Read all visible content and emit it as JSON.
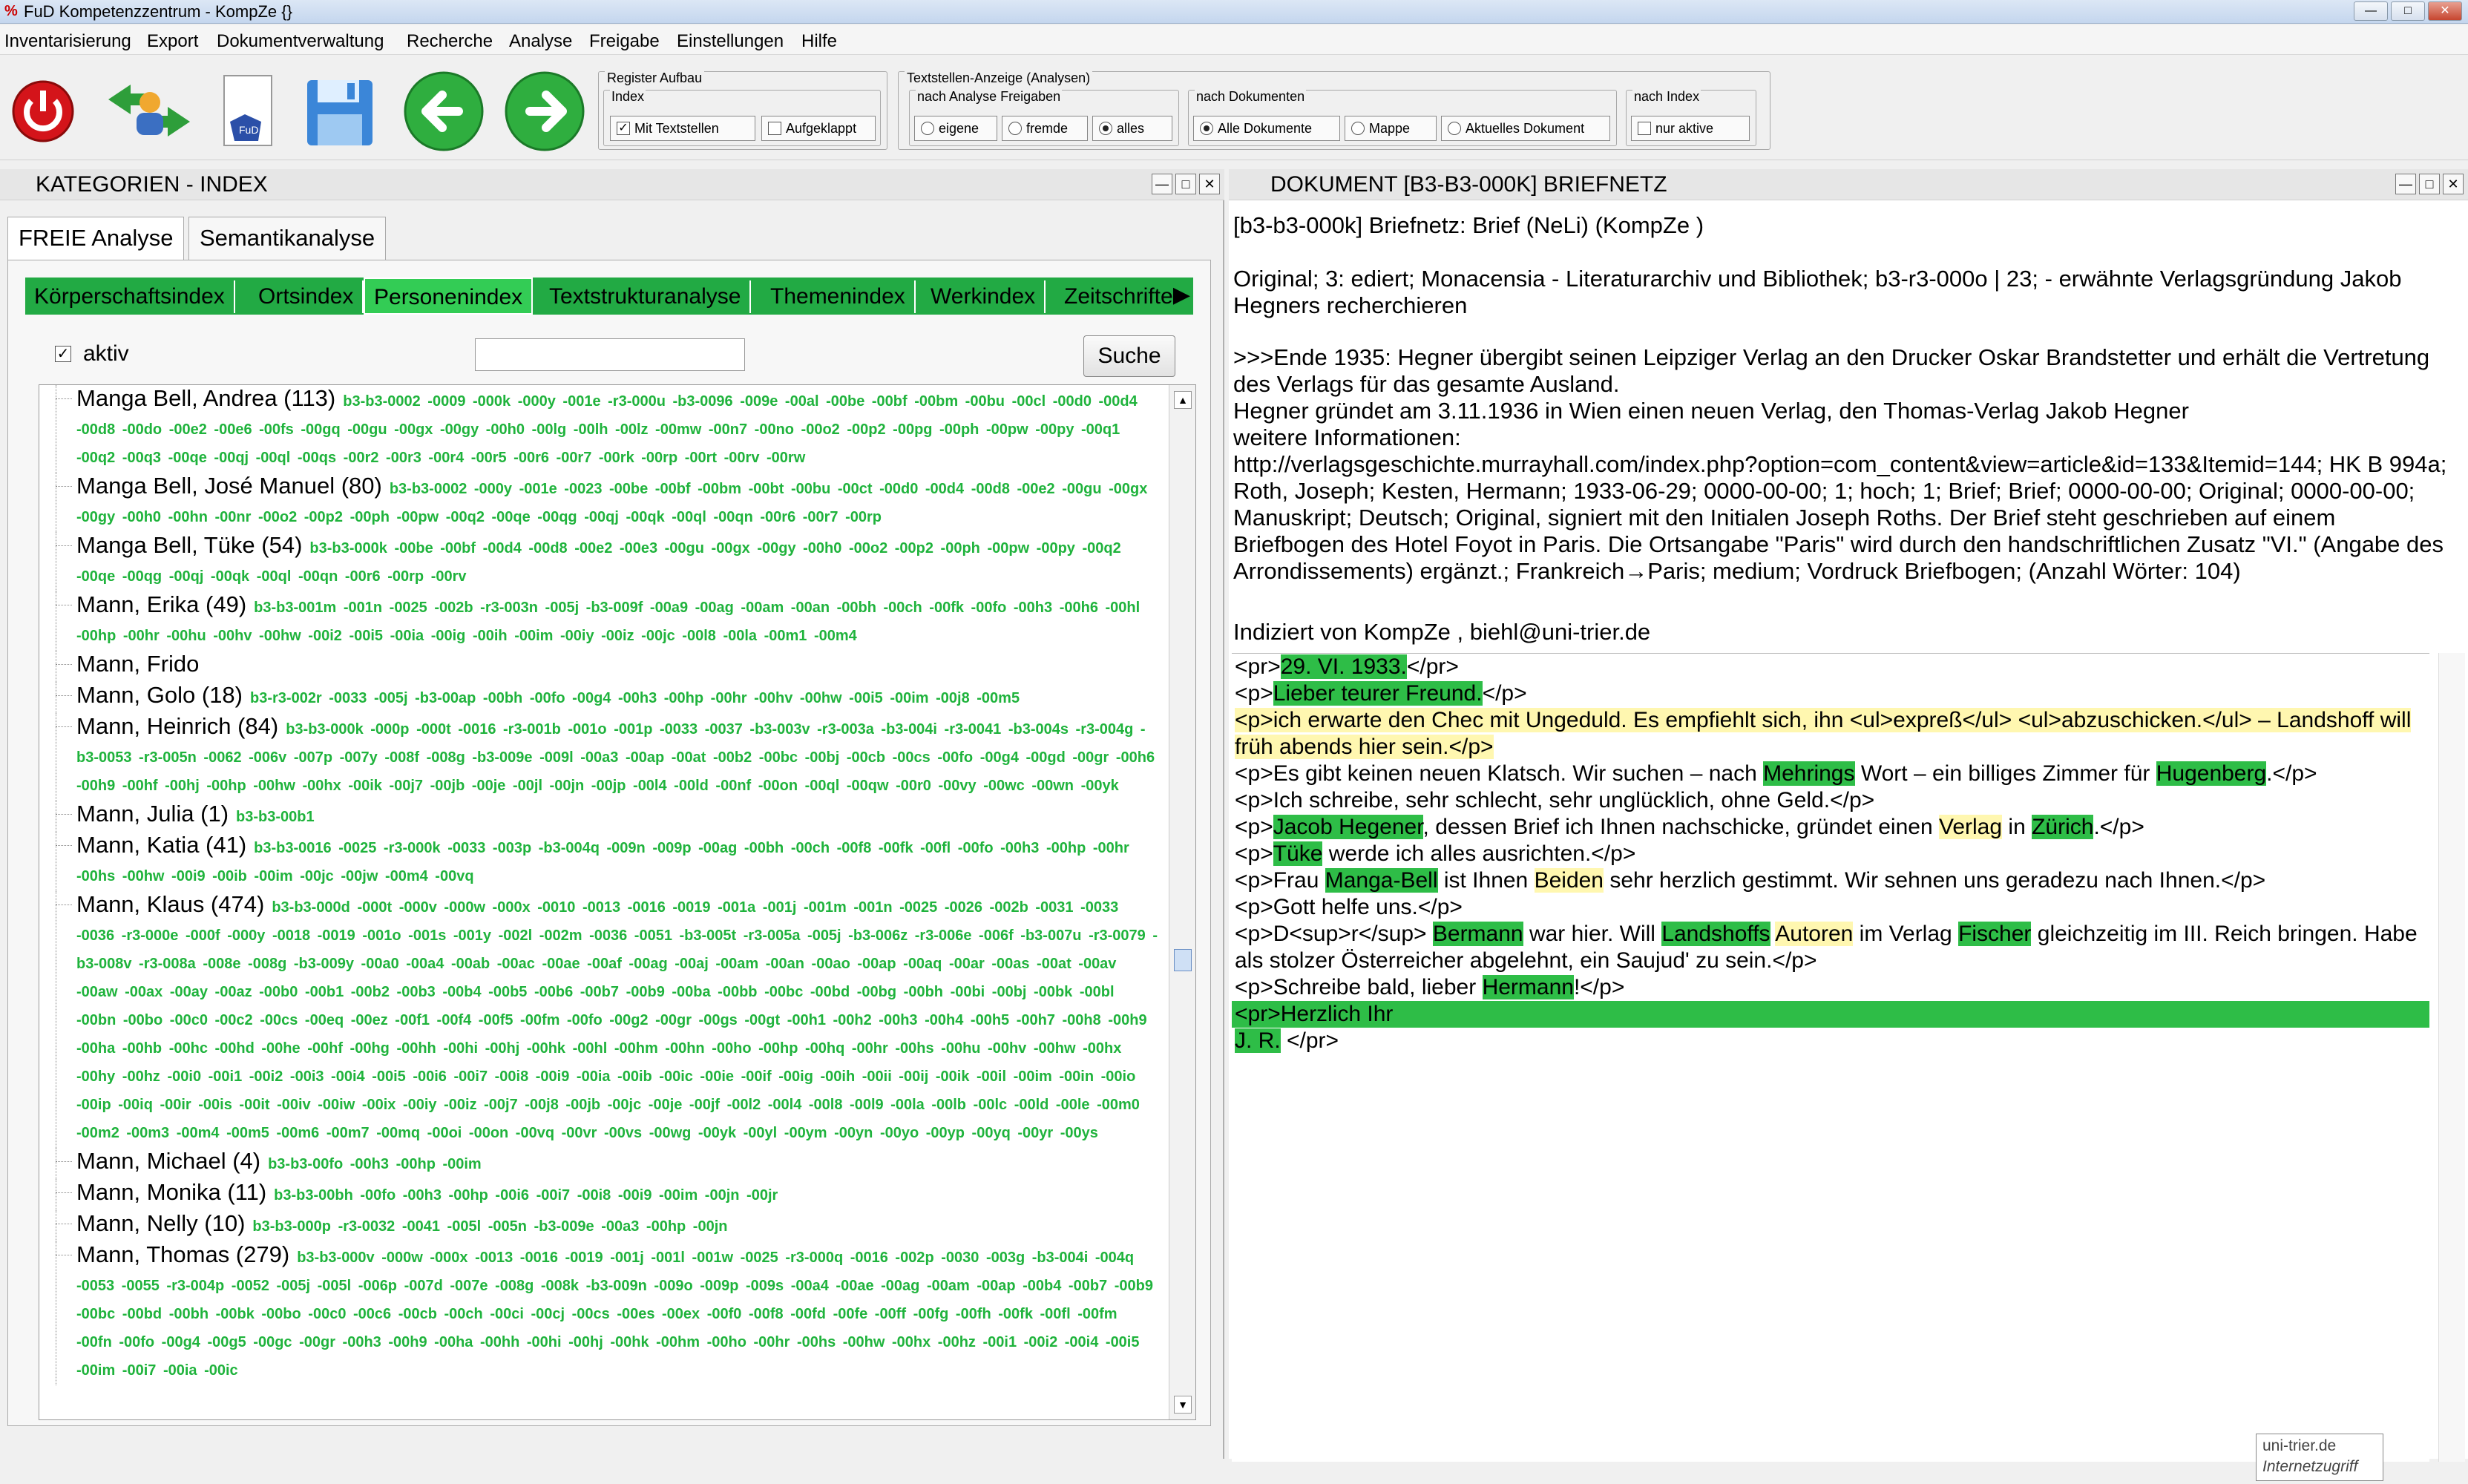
{
  "window": {
    "title": "FuD Kompetenzzentrum - KompZe {}",
    "app_icon": "fud-app-icon"
  },
  "menu": [
    "Inventarisierung",
    "Export",
    "Dokumentverwaltung",
    "Recherche",
    "Analyse",
    "Freigabe",
    "Einstellungen",
    "Hilfe"
  ],
  "toolbar": {
    "buttons": [
      {
        "name": "power-off-icon"
      },
      {
        "name": "users-sync-icon"
      },
      {
        "name": "fud-document-icon"
      },
      {
        "name": "save-disk-icon"
      },
      {
        "name": "arrow-left-icon"
      },
      {
        "name": "arrow-right-icon"
      }
    ],
    "register": {
      "title": "Register Aufbau",
      "index_title": "Index",
      "mit_textstellen": "Mit Textstellen",
      "aufgeklappt": "Aufgeklappt"
    },
    "textstellen": {
      "title": "Textstellen-Anzeige (Analysen)",
      "freigaben_title": "nach Analyse Freigaben",
      "eigene": "eigene",
      "fremde": "fremde",
      "alles": "alles",
      "dokumente_title": "nach Dokumenten",
      "alle_dokumente": "Alle Dokumente",
      "mappe": "Mappe",
      "aktuelles_dokument": "Aktuelles Dokument",
      "index_title": "nach Index",
      "nur_aktive": "nur aktive"
    }
  },
  "left_pane": {
    "title": "KATEGORIEN - INDEX",
    "tabs": [
      "FREIE Analyse",
      "Semantikanalyse"
    ],
    "category_tabs": [
      "Körperschaftsindex",
      "Ortsindex",
      "Personenindex",
      "Textstrukturanalyse",
      "Themenindex",
      "Werkindex",
      "Zeitschrifte"
    ],
    "filter": {
      "aktiv_label": "aktiv",
      "search_value": "",
      "search_button": "Suche"
    },
    "entries": [
      {
        "name": "Manga Bell, Andrea (113)",
        "codes": "b3-b3-0002 -0009 -000k -000y -001e -r3-000u -b3-0096 -009e -00al -00be -00bf -00bm -00bu -00cl -00d0 -00d4 -00d8 -00do -00e2 -00e6 -00fs -00gq -00gu -00gx -00gy -00h0 -00lg -00lh -00lz -00mw -00n7 -00no -00o2 -00p2 -00pg -00ph -00pw -00py -00q1 -00q2 -00q3 -00qe -00qj -00ql -00qs -00r2 -00r3 -00r4 -00r5 -00r6 -00r7 -00rk -00rp -00rt -00rv -00rw"
      },
      {
        "name": "Manga Bell, José Manuel (80)",
        "codes": "b3-b3-0002 -000y -001e -0023 -00be -00bf -00bm -00bt -00bu -00ct -00d0 -00d4 -00d8 -00e2 -00gu -00gx -00gy -00h0 -00hn -00nr -00o2 -00p2 -00ph -00pw -00q2 -00qe -00qg -00qj -00qk -00ql -00qn -00r6 -00r7 -00rp"
      },
      {
        "name": "Manga Bell, Tüke (54)",
        "codes": "b3-b3-000k -00be -00bf -00d4 -00d8 -00e2 -00e3 -00gu -00gx -00gy -00h0 -00o2 -00p2 -00ph -00pw -00py -00q2 -00qe -00qg -00qj -00qk -00ql -00qn -00r6 -00rp -00rv"
      },
      {
        "name": "Mann, Erika (49)",
        "codes": "b3-b3-001m -001n -0025 -002b -r3-003n -005j -b3-009f -00a9 -00ag -00am -00an -00bh -00ch -00fk -00fo -00h3 -00h6 -00hl -00hp -00hr -00hu -00hv -00hw -00i2 -00i5 -00ia -00ig -00ih -00im -00iy -00iz -00jc -00l8 -00la -00m1 -00m4"
      },
      {
        "name": "Mann, Frido",
        "codes": ""
      },
      {
        "name": "Mann, Golo  (18)",
        "codes": "b3-r3-002r -0033 -005j -b3-00ap -00bh -00fo -00g4 -00h3 -00hp -00hr -00hv -00hw -00i5 -00im -00j8 -00m5"
      },
      {
        "name": "Mann, Heinrich (84)",
        "codes": "b3-b3-000k -000p -000t -0016 -r3-001b -001o -001p -0033 -0037 -b3-003v -r3-003a -b3-004i -r3-0041 -b3-004s -r3-004g -b3-0053 -r3-005n -0062 -006v -007p -007y -008f -008g -b3-009e -009l -00a3 -00ap -00at -00b2 -00bc -00bj -00cb -00cs -00fo -00g4 -00gd -00gr -00h6 -00h9 -00hf -00hj -00hp -00hw -00hx -00ik -00j7 -00jb -00je -00jl -00jn -00jp -00l4 -00ld -00nf -00on -00ql -00qw -00r0 -00vy -00wc -00wn -00yk"
      },
      {
        "name": "Mann, Julia (1)",
        "codes": "b3-b3-00b1"
      },
      {
        "name": "Mann, Katia (41)",
        "codes": "b3-b3-0016 -0025 -r3-000k -0033 -003p -b3-004q -009n -009p -00ag -00bh -00ch -00f8 -00fk -00fl -00fo -00h3 -00hp -00hr -00hs -00hw -00i9 -00ib -00im -00jc -00jw -00m4 -00vq"
      },
      {
        "name": "Mann, Klaus (474)",
        "codes": "b3-b3-000d -000t -000v -000w -000x -0010 -0013 -0016 -0019 -001a -001j -001m -001n -0025 -0026 -002b -0031 -0033 -0036 -r3-000e -000f -000y -0018 -0019 -001o -001s -001y -002l -002m -0036 -0051 -b3-005t -r3-005a -005j -b3-006z -r3-006e -006f -b3-007u -r3-0079 -b3-008v -r3-008a -008e -008g -b3-009y -00a0 -00a4 -00ab -00ac -00ae -00af -00ag -00aj -00am -00an -00ao -00ap -00aq -00ar -00as -00at -00av -00aw -00ax -00ay -00az -00b0 -00b1 -00b2 -00b3 -00b4 -00b5 -00b6 -00b7 -00b9 -00ba -00bb -00bc -00bd -00bg -00bh -00bi -00bj -00bk -00bl -00bn -00bo -00c0 -00c2 -00cs -00eq -00ez -00f1 -00f4 -00f5 -00fm -00fo -00g2 -00gr -00gs -00gt -00h1 -00h2 -00h3 -00h4 -00h5 -00h7 -00h8 -00h9 -00ha -00hb -00hc -00hd -00he -00hf -00hg -00hh -00hi -00hj -00hk -00hl -00hm -00hn -00ho -00hp -00hq -00hr -00hs -00hu -00hv -00hw -00hx -00hy -00hz -00i0 -00i1 -00i2 -00i3 -00i4 -00i5 -00i6 -00i7 -00i8 -00i9 -00ia -00ib -00ic -00ie -00if -00ig -00ih -00ii -00ij -00ik -00il -00im -00in -00io -00ip -00iq -00ir -00is -00it -00iv -00iw -00ix -00iy -00iz -00j7 -00j8 -00jb -00jc -00je -00jf -00l2 -00l4 -00l8 -00l9 -00la -00lb -00lc -00ld -00le -00m0 -00m2 -00m3 -00m4 -00m5 -00m6 -00m7 -00mq -00oi -00on -00vq -00vr -00vs -00wg -00yk -00yl -00ym -00yn -00yo -00yp -00yq -00yr -00ys"
      },
      {
        "name": "Mann, Michael (4)",
        "codes": "b3-b3-00fo -00h3 -00hp -00im"
      },
      {
        "name": "Mann, Monika (11)",
        "codes": "b3-b3-00bh -00fo -00h3 -00hp -00i6 -00i7 -00i8 -00i9 -00im -00jn -00jr"
      },
      {
        "name": "Mann, Nelly (10)",
        "codes": "b3-b3-000p -r3-0032 -0041 -005l -005n -b3-009e -00a3 -00hp -00jn"
      },
      {
        "name": "Mann, Thomas  (279)",
        "codes": "b3-b3-000v -000w -000x -0013 -0016 -0019 -001j -001l -001w -0025 -r3-000q -0016 -002p -0030 -003g -b3-004i -004q -0053 -0055 -r3-004p -0052 -005j -005l -006p -007d -007e -008g -008k -b3-009n -009o -009p -009s -00a4 -00ae -00ag -00am -00ap -00b4 -00b7 -00b9 -00bc -00bd -00bh -00bk -00bo -00c0 -00c6 -00cb -00ch -00ci -00cj -00cs -00es -00ex -00f0 -00f8 -00fd -00fe -00ff -00fg -00fh -00fk -00fl -00fm -00fn -00fo -00g4 -00g5 -00gc -00gr -00h3 -00h9 -00ha -00hh -00hi -00hj -00hk -00hm -00ho -00hr -00hs -00hw -00hx -00hz -00i1 -00i2 -00i4 -00i5 -00im -00i7 -00ia -00ic"
      }
    ]
  },
  "right_pane": {
    "title": "DOKUMENT  [B3-B3-000K] BRIEFNETZ",
    "heading": "[b3-b3-000k] Briefnetz: Brief (NeLi) (KompZe )",
    "original_line": "Original;  3: ediert;  Monacensia - Literaturarchiv und Bibliothek; b3-r3-000o | 23; - erwähnte Verlagsgründung Jakob Hegners recherchieren",
    "note_lines": [
      ">>>Ende 1935: Hegner übergibt seinen Leipziger Verlag an den Drucker Oskar Brandstetter und erhält die Vertretung des Verlags für das gesamte Ausland.",
      "Hegner gründet am 3.11.1936 in Wien einen neuen Verlag, den Thomas-Verlag Jakob Hegner",
      "weitere Informationen:",
      "http://verlagsgeschichte.murrayhall.com/index.php?option=com_content&view=article&id=133&Itemid=144;  HK B 994a; Roth, Joseph; Kesten, Hermann; 1933-06-29; 0000-00-00; 1; hoch; 1; Brief; Brief; 0000-00-00; Original; 0000-00-00; Manuskript; Deutsch; Original, signiert mit den Initialen Joseph Roths. Der Brief steht geschrieben auf einem Briefbogen des Hotel Foyot in Paris. Die Ortsangabe \"Paris\" wird durch den handschriftlichen Zusatz \"VI.\" (Angabe des Arrondissements) ergänzt.;  Frankreich→Paris; medium;  Vordruck Briefbogen;   (Anzahl Wörter: 104)"
    ],
    "indexed_by": "Indiziert von KompZe , biehl@uni-trier.de",
    "editor_lines": [
      [
        {
          "t": "<pr>"
        },
        {
          "t": "29. VI. 1933.",
          "h": "g"
        },
        {
          "t": "</pr>"
        }
      ],
      [
        {
          "t": "<p>"
        },
        {
          "t": "Lieber teurer Freund.",
          "h": "g"
        },
        {
          "t": "</p>"
        }
      ],
      [
        {
          "t": "<p>ich erwarte den Chec mit Ungeduld. Es empfiehlt sich, ihn <ul>expreß</ul> <ul>abzuschicken.</ul> – Landshoff will früh abends hier sein.</p>",
          "h": "y"
        }
      ],
      [
        {
          "t": "<p>Es gibt keinen neuen Klatsch. Wir suchen – nach "
        },
        {
          "t": "Mehrings",
          "h": "g"
        },
        {
          "t": " Wort – ein billiges Zimmer für "
        },
        {
          "t": "Hugenberg",
          "h": "g"
        },
        {
          "t": ".</p>"
        }
      ],
      [
        {
          "t": "<p>Ich schreibe, sehr schlecht, sehr unglücklich, ohne Geld.</p>"
        }
      ],
      [
        {
          "t": "<p>"
        },
        {
          "t": "Jacob Hegener",
          "h": "g"
        },
        {
          "t": ", dessen Brief ich Ihnen nachschicke, gründet einen "
        },
        {
          "t": "Verlag",
          "h": "y"
        },
        {
          "t": " in "
        },
        {
          "t": "Zürich",
          "h": "g"
        },
        {
          "t": ".</p>"
        }
      ],
      [
        {
          "t": "<p>"
        },
        {
          "t": "Tüke",
          "h": "g"
        },
        {
          "t": " werde ich alles ausrichten.</p>"
        }
      ],
      [
        {
          "t": "<p>Frau "
        },
        {
          "t": "Manga-Bell",
          "h": "g"
        },
        {
          "t": " ist Ihnen "
        },
        {
          "t": "Beiden",
          "h": "y"
        },
        {
          "t": " sehr herzlich gestimmt. Wir sehnen uns geradezu nach Ihnen.</p>"
        }
      ],
      [
        {
          "t": "<p>Gott helfe uns.</p>"
        }
      ],
      [
        {
          "t": "<p>D<sup>r</sup> "
        },
        {
          "t": "Bermann",
          "h": "g"
        },
        {
          "t": " war hier. Will "
        },
        {
          "t": "Landshoffs",
          "h": "g"
        },
        {
          "t": " "
        },
        {
          "t": "Autoren",
          "h": "y"
        },
        {
          "t": " im Verlag "
        },
        {
          "t": "Fischer",
          "h": "g"
        },
        {
          "t": " gleichzeitig im III. Reich bringen. Habe als stolzer Österreicher abgelehnt, ein Saujud' zu sein.</p>"
        }
      ],
      [
        {
          "t": "<p>Schreibe bald, lieber "
        },
        {
          "t": "Hermann",
          "h": "g"
        },
        {
          "t": "!</p>"
        }
      ],
      [
        {
          "t": "<pr>Herzlich Ihr",
          "full": "g"
        }
      ],
      [
        {
          "t": "J. R.",
          "h": "g"
        },
        {
          "t": " </pr>"
        }
      ]
    ]
  },
  "status_tooltip": {
    "line1": "uni-trier.de",
    "line2": "Internetzugriff"
  }
}
